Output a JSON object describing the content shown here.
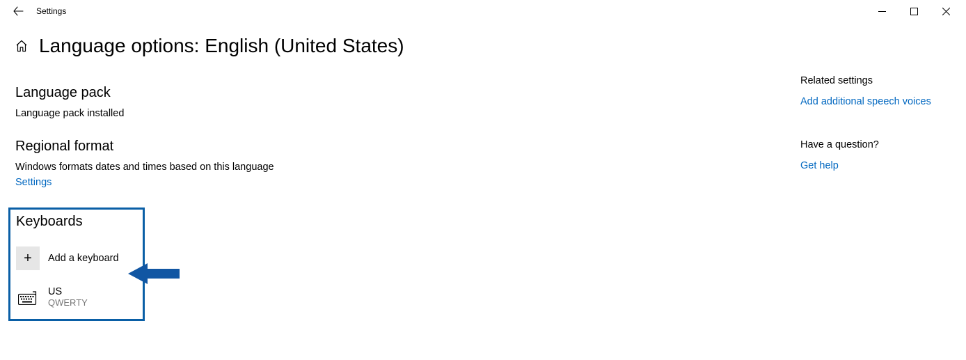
{
  "window": {
    "title": "Settings"
  },
  "page": {
    "title": "Language options: English (United States)"
  },
  "sections": {
    "language_pack": {
      "heading": "Language pack",
      "status": "Language pack installed"
    },
    "regional_format": {
      "heading": "Regional format",
      "desc": "Windows formats dates and times based on this language",
      "link": "Settings"
    },
    "keyboards": {
      "heading": "Keyboards",
      "add_label": "Add a keyboard",
      "items": [
        {
          "name": "US",
          "layout": "QWERTY"
        }
      ]
    }
  },
  "sidebar": {
    "related_heading": "Related settings",
    "related_link": "Add additional speech voices",
    "question_heading": "Have a question?",
    "question_link": "Get help"
  },
  "colors": {
    "link": "#0067c0",
    "highlight": "#0a5fa6",
    "arrow": "#1156a3",
    "muted": "#767676"
  }
}
